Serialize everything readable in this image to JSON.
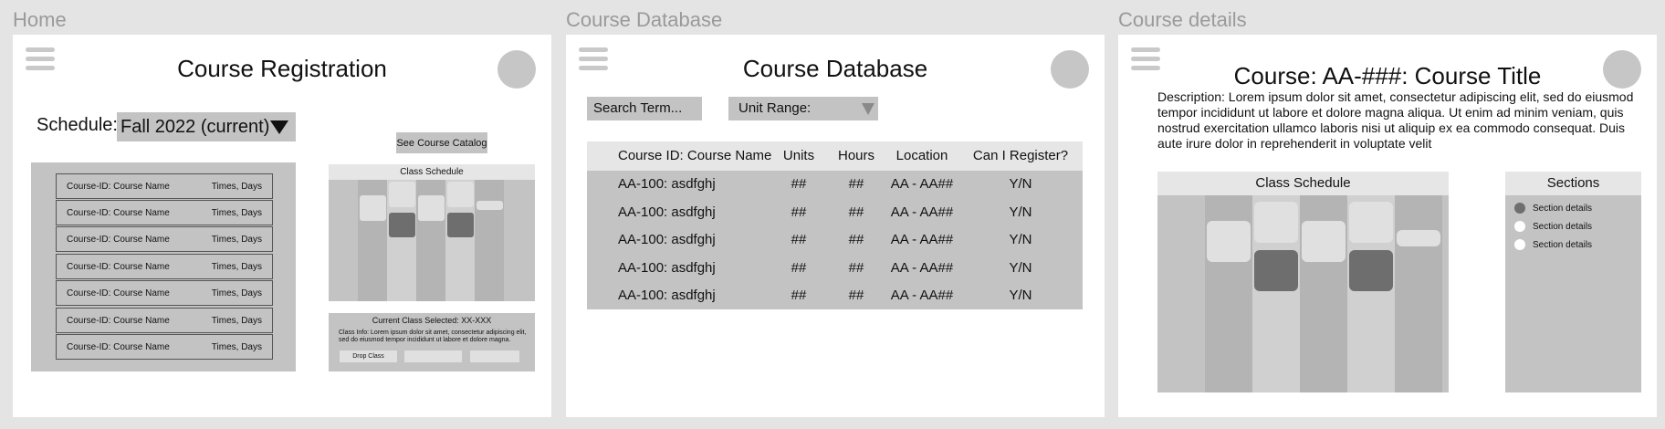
{
  "frames": {
    "home_label": "Home",
    "database_label": "Course Database",
    "details_label": "Course details"
  },
  "home": {
    "title": "Course Registration",
    "schedule_label": "Schedule:",
    "schedule_value": "Fall 2022 (current)",
    "catalog_button": "See Course Catalog",
    "courses": [
      {
        "name": "Course-ID: Course Name",
        "times": "Times, Days"
      },
      {
        "name": "Course-ID: Course Name",
        "times": "Times, Days"
      },
      {
        "name": "Course-ID: Course Name",
        "times": "Times, Days"
      },
      {
        "name": "Course-ID: Course Name",
        "times": "Times, Days"
      },
      {
        "name": "Course-ID: Course Name",
        "times": "Times, Days"
      },
      {
        "name": "Course-ID: Course Name",
        "times": "Times, Days"
      },
      {
        "name": "Course-ID: Course Name",
        "times": "Times, Days"
      }
    ],
    "class_schedule_title": "Class Schedule",
    "current_class": "Current Class Selected: XX-XXX",
    "class_info": "Class Info: Lorem ipsum dolor sit amet, consectetur adipiscing elit, sed do eiusmod tempor incididunt ut labore et dolore magna.",
    "drop_button": "Drop Class"
  },
  "database": {
    "title": "Course Database",
    "search_placeholder": "Search Term...",
    "unit_range": "Unit Range:",
    "columns": [
      "Course ID: Course Name",
      "Units",
      "Hours",
      "Location",
      "Can I Register?"
    ],
    "rows": [
      [
        "AA-100: asdfghj",
        "##",
        "##",
        "AA - AA##",
        "Y/N"
      ],
      [
        "AA-100: asdfghj",
        "##",
        "##",
        "AA - AA##",
        "Y/N"
      ],
      [
        "AA-100: asdfghj",
        "##",
        "##",
        "AA - AA##",
        "Y/N"
      ],
      [
        "AA-100: asdfghj",
        "##",
        "##",
        "AA - AA##",
        "Y/N"
      ],
      [
        "AA-100: asdfghj",
        "##",
        "##",
        "AA - AA##",
        "Y/N"
      ]
    ]
  },
  "details": {
    "title": "Course: AA-###: Course Title",
    "description": "Description: Lorem ipsum dolor sit amet, consectetur adipiscing elit, sed do eiusmod tempor incididunt ut labore et dolore magna aliqua. Ut enim ad minim veniam, quis nostrud exercitation ullamco laboris nisi ut aliquip ex ea commodo consequat. Duis aute irure dolor in reprehenderit in voluptate velit",
    "class_schedule_title": "Class Schedule",
    "sections_title": "Sections",
    "sections": [
      {
        "label": "Section details",
        "selected": true
      },
      {
        "label": "Section details",
        "selected": false
      },
      {
        "label": "Section details",
        "selected": false
      }
    ]
  },
  "colors": {
    "background": "#e4e4e4",
    "panel": "#c3c3c3",
    "header": "#e6e6e6",
    "dark_block": "#6e6e6e",
    "light_block": "#e0e0e0"
  }
}
